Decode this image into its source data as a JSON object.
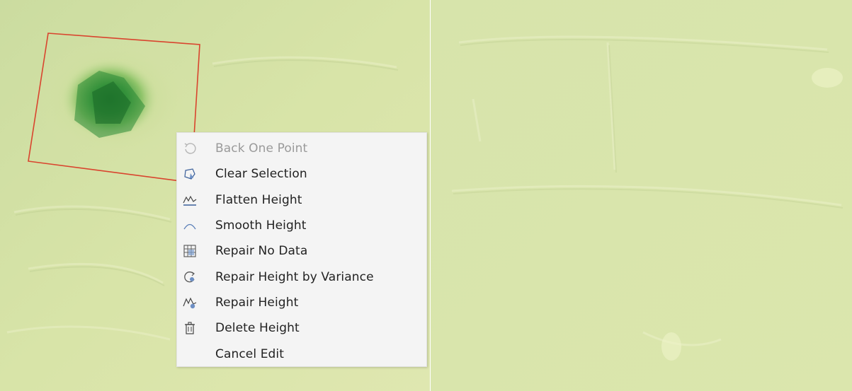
{
  "colors": {
    "terrain_base": "#d7e3a6",
    "terrain_highlight": "#eef3c8",
    "terrain_shadow": "#b9c98a",
    "hill_dark": "#1f7a2e",
    "hill_mid": "#4fa54a",
    "hill_light": "#a9cf7a",
    "selection_outline": "#d9442e",
    "menu_background": "#f4f4f4",
    "menu_text": "#222222",
    "menu_text_disabled": "#9a9a9a",
    "icon_stroke": "#3a5f9a"
  },
  "context_menu": {
    "items": [
      {
        "label": "Back One Point",
        "icon": "undo-icon",
        "enabled": false
      },
      {
        "label": "Clear Selection",
        "icon": "clear-selection-icon",
        "enabled": true
      },
      {
        "label": "Flatten Height",
        "icon": "flatten-height-icon",
        "enabled": true
      },
      {
        "label": "Smooth Height",
        "icon": "smooth-height-icon",
        "enabled": true
      },
      {
        "label": "Repair No Data",
        "icon": "repair-no-data-icon",
        "enabled": true
      },
      {
        "label": "Repair Height by Variance",
        "icon": "repair-variance-icon",
        "enabled": true
      },
      {
        "label": "Repair Height",
        "icon": "repair-height-icon",
        "enabled": true
      },
      {
        "label": "Delete Height",
        "icon": "trash-icon",
        "enabled": true
      },
      {
        "label": "Cancel Edit",
        "icon": "",
        "enabled": true
      }
    ]
  }
}
